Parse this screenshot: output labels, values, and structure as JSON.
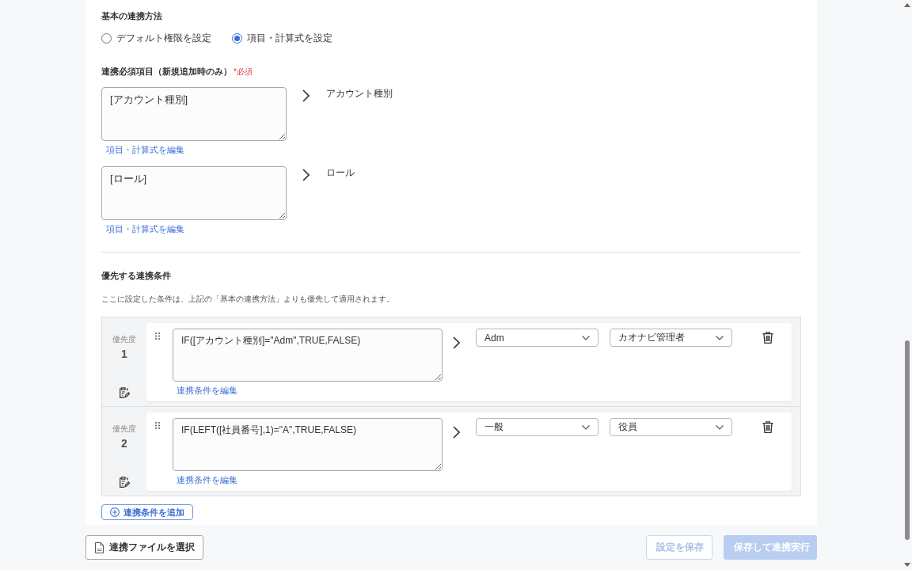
{
  "basic_method": {
    "title": "基本の連携方法",
    "options": [
      {
        "label": "デフォルト権限を設定",
        "selected": false
      },
      {
        "label": "項目・計算式を設定",
        "selected": true
      }
    ]
  },
  "required_items": {
    "title": "連携必須項目（新規追加時のみ）",
    "required_mark": "*必須",
    "items": [
      {
        "formula": "[アカウント種別]",
        "target": "アカウント種別",
        "edit_link": "項目・計算式を編集"
      },
      {
        "formula": "[ロール]",
        "target": "ロール",
        "edit_link": "項目・計算式を編集"
      }
    ]
  },
  "priority_conditions": {
    "title": "優先する連携条件",
    "description": "ここに設定した条件は、上記の「基本の連携方法」よりも優先して適用されます。",
    "rows": [
      {
        "priority_label": "優先度",
        "priority": "1",
        "formula": "IF([アカウント種別]=\"Adm\",TRUE,FALSE)",
        "edit_link": "連携条件を編集",
        "value": "Adm",
        "role": "カオナビ管理者"
      },
      {
        "priority_label": "優先度",
        "priority": "2",
        "formula": "IF(LEFT([社員番号],1)=\"A\",TRUE,FALSE)",
        "edit_link": "連携条件を編集",
        "value": "一般",
        "role": "役員"
      }
    ],
    "add_button": "連携条件を追加"
  },
  "footer": {
    "file_button": "連携ファイルを選択",
    "buttons": [
      {
        "label": "設定を保存",
        "kind": "secondary",
        "disabled": true
      },
      {
        "label": "保存して連携実行",
        "kind": "primary",
        "disabled": true
      }
    ]
  }
}
